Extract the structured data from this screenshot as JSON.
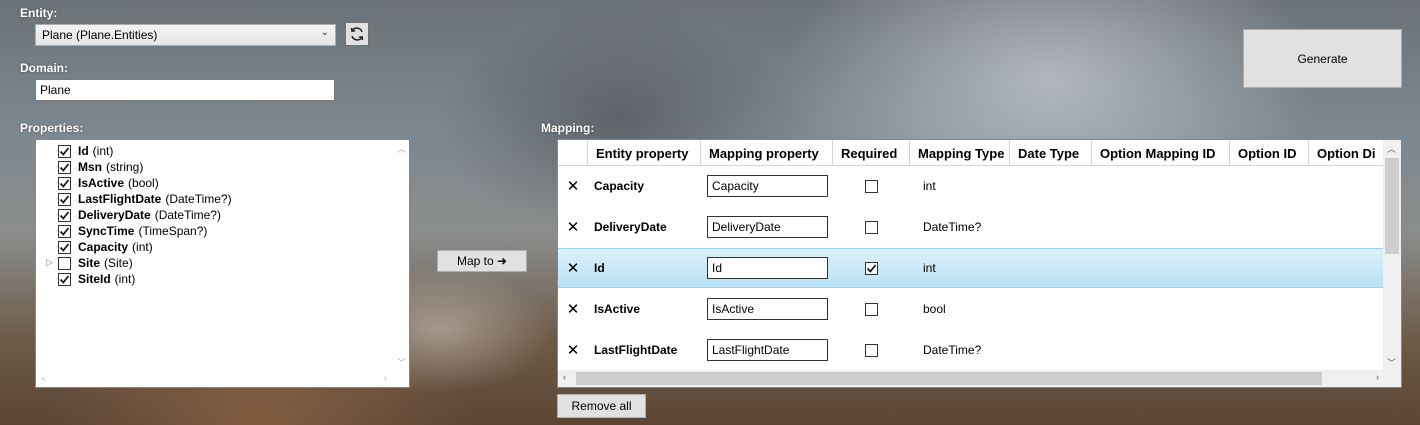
{
  "labels": {
    "entity": "Entity:",
    "domain": "Domain:",
    "properties": "Properties:",
    "mapping": "Mapping:"
  },
  "entity_combo": {
    "value": "Plane (Plane.Entities)"
  },
  "domain_field": {
    "value": "Plane"
  },
  "buttons": {
    "generate": "Generate",
    "map_to": "Map to ➜",
    "remove_all": "Remove all"
  },
  "properties": [
    {
      "name": "Id",
      "type": "(int)",
      "checked": true,
      "expandable": false
    },
    {
      "name": "Msn",
      "type": "(string)",
      "checked": true,
      "expandable": false
    },
    {
      "name": "IsActive",
      "type": "(bool)",
      "checked": true,
      "expandable": false
    },
    {
      "name": "LastFlightDate",
      "type": "(DateTime?)",
      "checked": true,
      "expandable": false
    },
    {
      "name": "DeliveryDate",
      "type": "(DateTime?)",
      "checked": true,
      "expandable": false
    },
    {
      "name": "SyncTime",
      "type": "(TimeSpan?)",
      "checked": true,
      "expandable": false
    },
    {
      "name": "Capacity",
      "type": "(int)",
      "checked": true,
      "expandable": false
    },
    {
      "name": "Site",
      "type": "(Site)",
      "checked": false,
      "expandable": true
    },
    {
      "name": "SiteId",
      "type": "(int)",
      "checked": true,
      "expandable": false
    }
  ],
  "mapping": {
    "columns": [
      "",
      "Entity property",
      "Mapping property",
      "Required",
      "Mapping Type",
      "Date Type",
      "Option Mapping ID",
      "Option ID",
      "Option Di"
    ],
    "rows": [
      {
        "entity_property": "Capacity",
        "mapping_property": "Capacity",
        "required": false,
        "mapping_type": "int",
        "selected": false
      },
      {
        "entity_property": "DeliveryDate",
        "mapping_property": "DeliveryDate",
        "required": false,
        "mapping_type": "DateTime?",
        "selected": false
      },
      {
        "entity_property": "Id",
        "mapping_property": "Id",
        "required": true,
        "mapping_type": "int",
        "selected": true
      },
      {
        "entity_property": "IsActive",
        "mapping_property": "IsActive",
        "required": false,
        "mapping_type": "bool",
        "selected": false
      },
      {
        "entity_property": "LastFlightDate",
        "mapping_property": "LastFlightDate",
        "required": false,
        "mapping_type": "DateTime?",
        "selected": false
      }
    ]
  }
}
